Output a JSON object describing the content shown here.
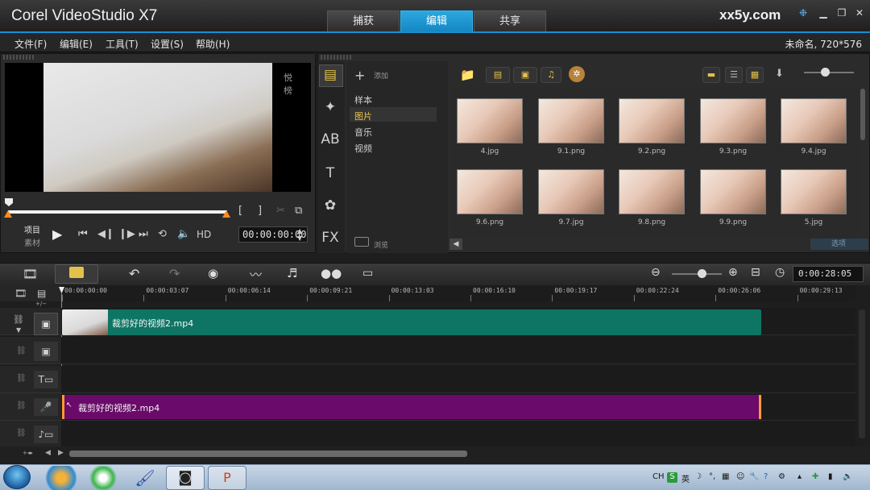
{
  "app": {
    "title": "Corel VideoStudio X7",
    "watermark": "xx5y.com"
  },
  "main_tabs": [
    {
      "label": "捕获",
      "active": false
    },
    {
      "label": "编辑",
      "active": true
    },
    {
      "label": "共享",
      "active": false
    }
  ],
  "window_controls": {
    "minimize": "▁",
    "maximize": "❐",
    "close": "✕"
  },
  "menu": [
    "文件(F)",
    "编辑(E)",
    "工具(T)",
    "设置(S)",
    "帮助(H)"
  ],
  "project_info": "未命名, 720*576",
  "preview": {
    "video_watermark": "悦榜",
    "mode_project": "项目",
    "mode_clip": "素材",
    "hd_label": "HD",
    "timecode": "00:00:00:00",
    "bracket_in": "[",
    "bracket_out": "]"
  },
  "library": {
    "add_label": "添加",
    "categories": [
      "样本",
      "图片",
      "音乐",
      "视频"
    ],
    "selected_category": "图片",
    "browse_label": "浏览",
    "options_label": "选项",
    "side_icons": [
      "media-icon",
      "instant-project-icon",
      "transition-icon",
      "title-icon",
      "graphic-icon",
      "filter-icon"
    ],
    "side_glyphs": [
      "▤",
      "✦",
      "AB",
      "T",
      "✿",
      "FX"
    ],
    "thumbnails_row1": [
      "4.jpg",
      "9.1.png",
      "9.2.png",
      "9.3.png",
      "9.4.jpg"
    ],
    "thumbnails_row2": [
      "9.6.png",
      "9.7.jpg",
      "9.8.png",
      "9.9.png",
      "5.jpg"
    ]
  },
  "timeline": {
    "duration": "0:00:28:05",
    "zoom_level": 0.6,
    "ruler_ticks": [
      "00:00:00:00",
      "00:00:03:07",
      "00:00:06:14",
      "00:00:09:21",
      "00:00:13:03",
      "00:00:16:10",
      "00:00:19:17",
      "00:00:22:24",
      "00:00:26:06",
      "00:00:29:13"
    ],
    "video_clip": "裁剪好的视频2.mp4",
    "audio_clip": "裁剪好的视频2.mp4",
    "add_track_label": "+/−",
    "tracks": [
      "video-track",
      "overlay-track",
      "title-track",
      "voice-track",
      "music-track"
    ]
  },
  "taskbar": {
    "tray_text": [
      "CH",
      "S",
      "英"
    ],
    "apps": [
      "ie-icon",
      "360-icon",
      "paint-icon",
      "videostudio-icon",
      "powerpoint-icon"
    ]
  },
  "colors": {
    "accent": "#1a8fd0",
    "video_clip": "#0e7564",
    "audio_clip": "#6a0a6a",
    "clip_edge": "#ff9b2e"
  }
}
